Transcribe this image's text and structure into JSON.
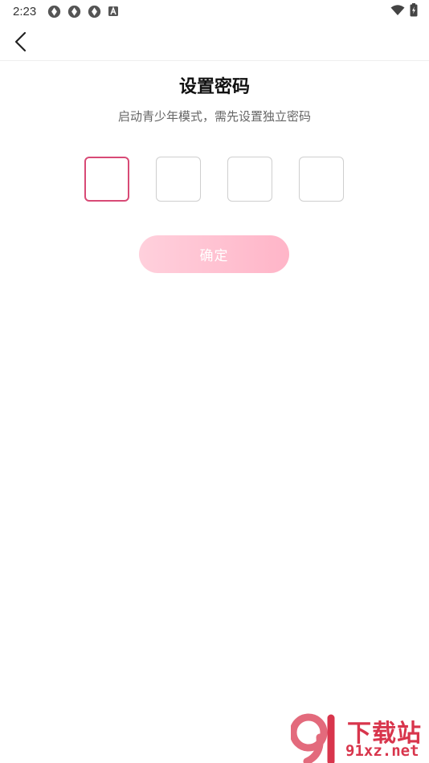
{
  "status_bar": {
    "time": "2:23",
    "left_icons": [
      "aperture-icon",
      "aperture-icon",
      "aperture-icon",
      "a-box-icon"
    ],
    "right_icons": [
      "wifi-icon",
      "battery-charging-icon"
    ]
  },
  "nav": {
    "back_icon": "chevron-left-icon"
  },
  "page": {
    "title": "设置密码",
    "subtitle": "启动青少年模式，需先设置独立密码"
  },
  "code_input": {
    "length": 4,
    "active_index": 0,
    "active_color": "#d84a76",
    "border_color": "#cfcfcf"
  },
  "confirm": {
    "label": "确定",
    "gradient_start": "#ffd0dc",
    "gradient_end": "#ffb5c8"
  },
  "watermark": {
    "title": "下载站",
    "domain": "91xz.net",
    "color": "#d8354c"
  }
}
